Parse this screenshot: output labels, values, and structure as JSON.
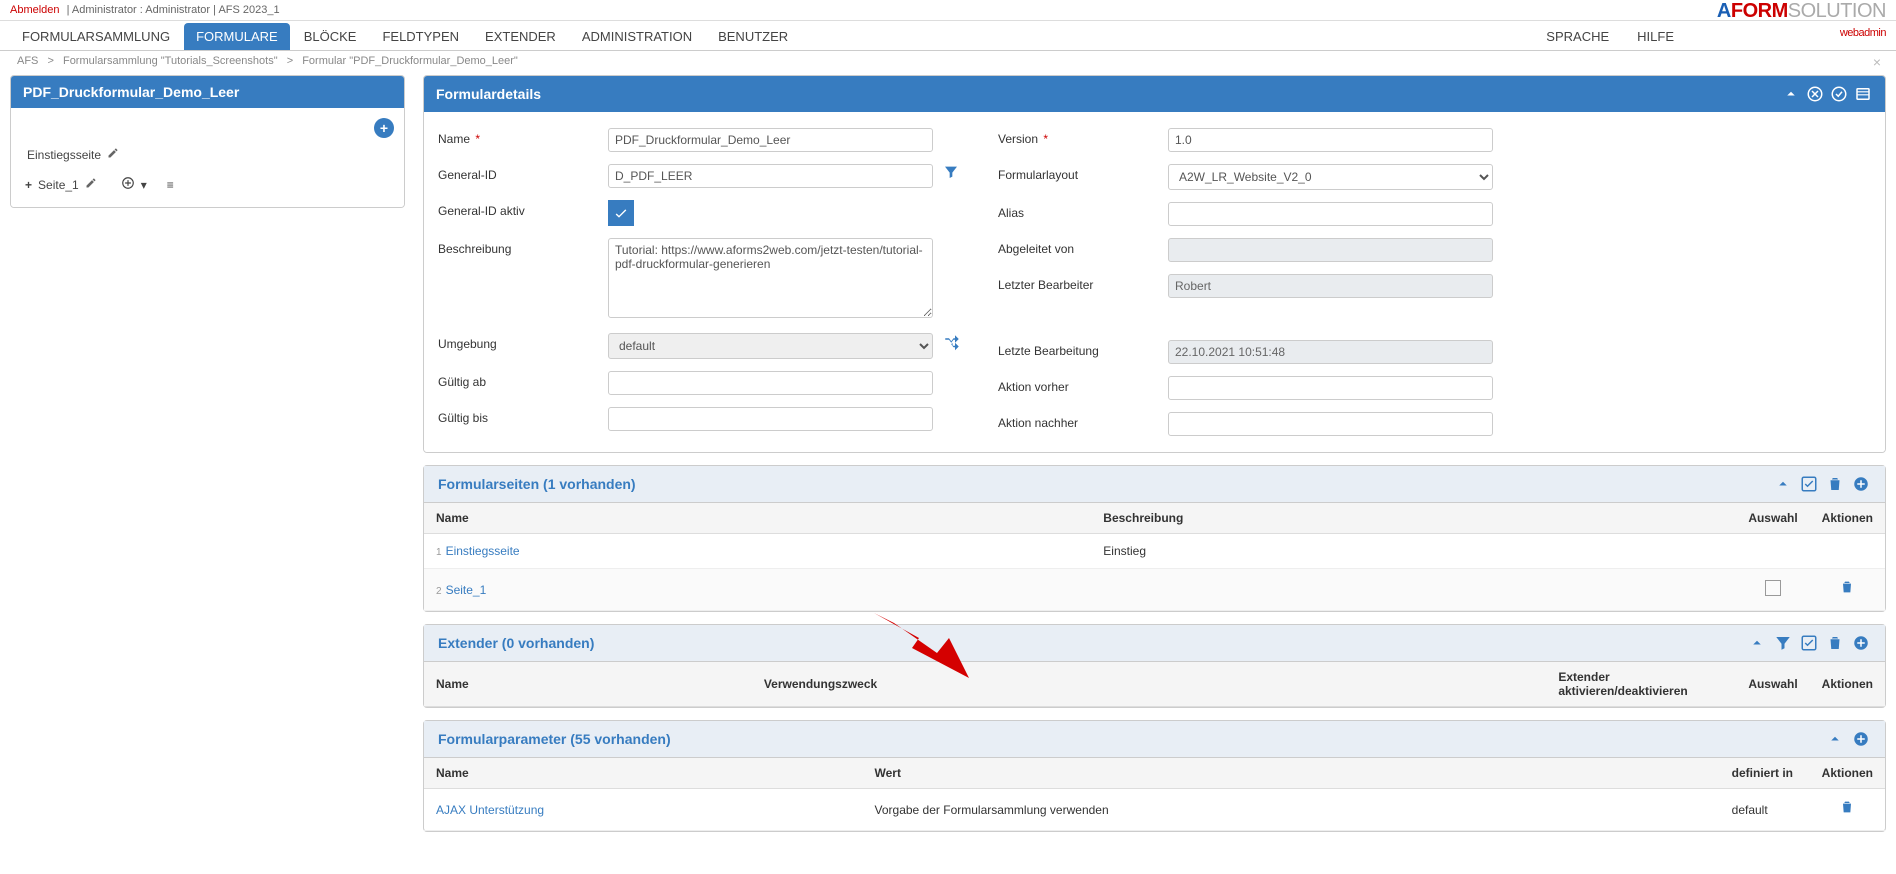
{
  "userbar": {
    "logout": "Abmelden",
    "separator": "|",
    "userinfo": "Administrator : Administrator | AFS 2023_1"
  },
  "logo": {
    "a": "A",
    "form": "FORM",
    "sol": "SOLUTION",
    "sub": "webadmin"
  },
  "nav": {
    "items": [
      "FORMULARSAMMLUNG",
      "FORMULARE",
      "BLÖCKE",
      "FELDTYPEN",
      "EXTENDER",
      "ADMINISTRATION",
      "BENUTZER"
    ],
    "active": "FORMULARE",
    "right": [
      "SPRACHE",
      "HILFE"
    ]
  },
  "breadcrumb": {
    "items": [
      "AFS",
      "Formularsammlung \"Tutorials_Screenshots\"",
      "Formular \"PDF_Druckformular_Demo_Leer\""
    ],
    "sep": ">"
  },
  "tree": {
    "title": "PDF_Druckformular_Demo_Leer",
    "entry": "Einstiegsseite",
    "page1": "Seite_1"
  },
  "details": {
    "header": "Formulardetails",
    "labels": {
      "name": "Name",
      "generalid": "General-ID",
      "generalid_aktiv": "General-ID aktiv",
      "beschreibung": "Beschreibung",
      "umgebung": "Umgebung",
      "gueltig_ab": "Gültig ab",
      "gueltig_bis": "Gültig bis",
      "version": "Version",
      "layout": "Formularlayout",
      "alias": "Alias",
      "abgeleitet": "Abgeleitet von",
      "bearbeiter": "Letzter Bearbeiter",
      "bearbeitung": "Letzte Bearbeitung",
      "aktion_vorher": "Aktion vorher",
      "aktion_nachher": "Aktion nachher"
    },
    "values": {
      "name": "PDF_Druckformular_Demo_Leer",
      "generalid": "D_PDF_LEER",
      "beschreibung": "Tutorial: https://www.aforms2web.com/jetzt-testen/tutorial-pdf-druckformular-generieren",
      "umgebung": "default",
      "version": "1.0",
      "layout": "A2W_LR_Website_V2_0",
      "bearbeiter": "Robert",
      "bearbeitung": "22.10.2021 10:51:48"
    }
  },
  "sections": {
    "seiten": {
      "title": "Formularseiten (1 vorhanden)",
      "cols": {
        "name": "Name",
        "descr": "Beschreibung",
        "auswahl": "Auswahl",
        "aktionen": "Aktionen"
      },
      "rows": [
        {
          "idx": "1",
          "name": "Einstiegsseite",
          "descr": "Einstieg",
          "checkbox": false,
          "trash": false
        },
        {
          "idx": "2",
          "name": "Seite_1",
          "descr": "",
          "checkbox": true,
          "trash": true
        }
      ]
    },
    "extender": {
      "title": "Extender (0 vorhanden)",
      "cols": {
        "name": "Name",
        "zweck": "Verwendungszweck",
        "activate": "Extender aktivieren/deaktivieren",
        "auswahl": "Auswahl",
        "aktionen": "Aktionen"
      }
    },
    "params": {
      "title": "Formularparameter (55 vorhanden)",
      "cols": {
        "name": "Name",
        "wert": "Wert",
        "defin": "definiert in",
        "aktionen": "Aktionen"
      },
      "rows": [
        {
          "name": "AJAX Unterstützung",
          "wert": "Vorgabe der Formularsammlung verwenden",
          "defin": "default"
        }
      ]
    }
  }
}
